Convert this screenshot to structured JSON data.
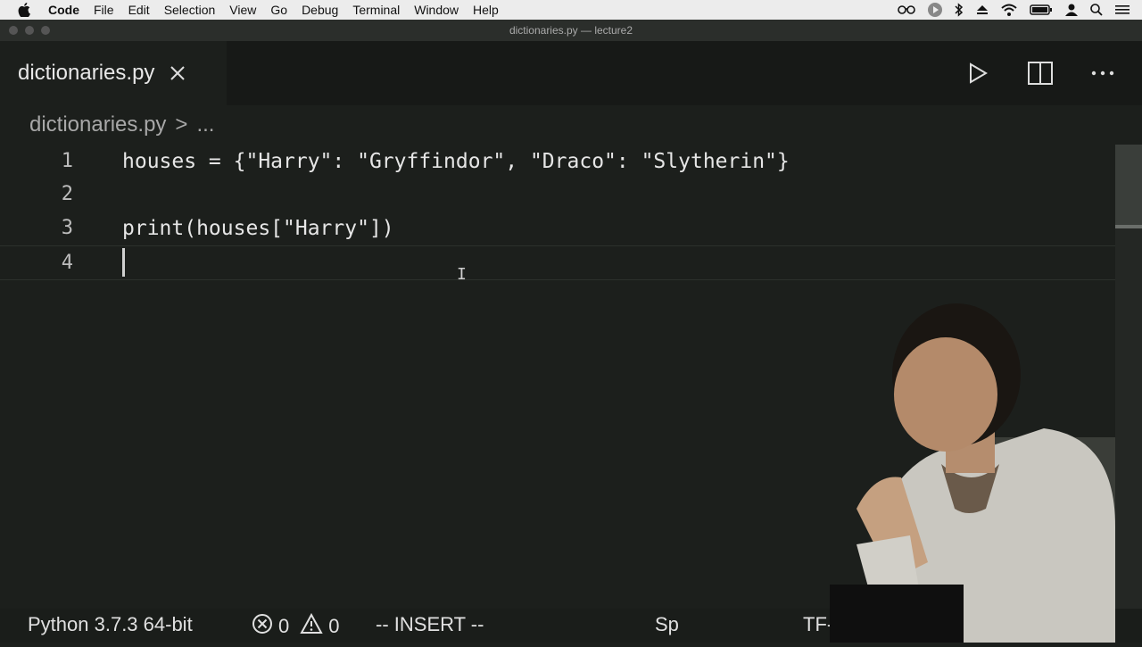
{
  "menubar": {
    "app_name": "Code",
    "items": [
      "File",
      "Edit",
      "Selection",
      "View",
      "Go",
      "Debug",
      "Terminal",
      "Window",
      "Help"
    ],
    "status_icons": [
      "glasses-icon",
      "record-icon",
      "bluetooth-icon",
      "eject-icon",
      "wifi-icon",
      "battery-icon",
      "user-icon",
      "search-icon",
      "list-icon"
    ]
  },
  "window": {
    "title": "dictionaries.py — lecture2"
  },
  "tab": {
    "label": "dictionaries.py"
  },
  "breadcrumb": {
    "file": "dictionaries.py",
    "separator": ">",
    "rest": "..."
  },
  "editor": {
    "lines": [
      {
        "number": "1",
        "text": "houses = {\"Harry\": \"Gryffindor\", \"Draco\": \"Slytherin\"}"
      },
      {
        "number": "2",
        "text": ""
      },
      {
        "number": "3",
        "text": "print(houses[\"Harry\"])"
      },
      {
        "number": "4",
        "text": ""
      }
    ]
  },
  "statusbar": {
    "interpreter": "Python 3.7.3 64-bit",
    "errors": "0",
    "warnings": "0",
    "mode": "-- INSERT --",
    "spaces_partial": "Sp",
    "encoding_partial": "TF-8"
  },
  "colors": {
    "background": "#1c1f1c",
    "menubar": "#ececec",
    "text": "#e6e6e6"
  }
}
